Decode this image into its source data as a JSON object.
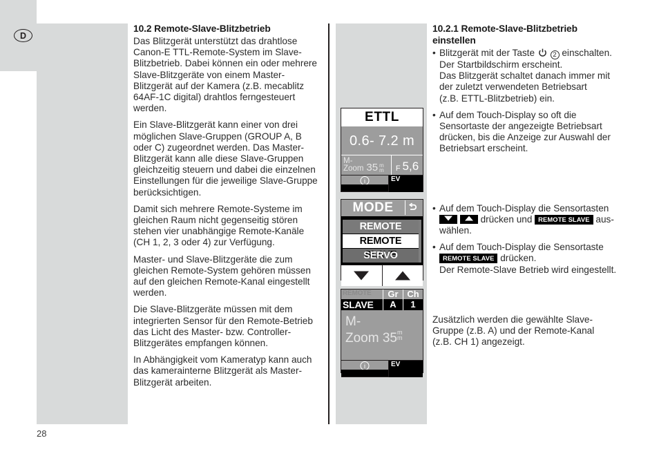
{
  "page": {
    "number": "28",
    "locale_badge": "D"
  },
  "left_column": {
    "heading": "10.2 Remote-Slave-Blitzbetrieb",
    "paragraphs": [
      "Das Blitzgerät unterstützt das drahtlose Canon-E TTL-Remote-System im Slave-Blitzbetrieb. Dabei können ein oder mehrere Slave-Blitzgeräte von einem Master-Blitzgerät auf der Kamera (z.B. mecablitz 64AF-1C digital) drahtlos ferngesteuert werden.",
      "Ein Slave-Blitzgerät kann einer von drei möglichen Slave-Gruppen (GROUP A, B oder C) zugeordnet werden. Das Master-Blitzgerät kann alle diese Slave-Gruppen gleichzeitig steuern und dabei die einzelnen Einstellungen für die jeweilige Slave-Gruppe berücksichtigen.",
      "Damit sich mehrere Remote-Systeme im gleichen Raum nicht gegenseitig stören stehen vier unabhängige Remote-Kanäle (CH 1, 2, 3 oder 4) zur Verfügung.",
      "Master- und Slave-Blitzgeräte die zum gleichen Remote-System gehören müssen auf den gleichen Remote-Kanal eingestellt werden.",
      "Die Slave-Blitzgeräte müssen mit dem integrierten Sensor für den Remote-Betrieb  das Licht des Master- bzw. Controller-Blitzgerätes empfangen können.",
      "In Abhängigkeit vom Kameratyp kann auch das kamerainterne Blitzgerät als Master-Blitzgerät arbeiten."
    ]
  },
  "right_column": {
    "heading": "10.2.1 Remote-Slave-Blitzbetrieb einstellen",
    "bullet1": {
      "lead": "Blitzgerät mit der Taste",
      "button_number": "2",
      "after": "einschalten.",
      "line2": "Der Startbildschirm erscheint.",
      "line3": "Das Blitzgerät schaltet danach immer mit",
      "line4": "der zuletzt verwendeten Betriebsart",
      "line5": "(z.B. ETTL-Blitzbetrieb) ein."
    },
    "bullet2": {
      "line1": "Auf dem Touch-Display so oft die",
      "line2": "Sensortaste der angezeigte Betriebsart",
      "line3": "drücken, bis die Anzeige zur Auswahl der",
      "line4": "Betriebsart erscheint."
    },
    "bullet3": {
      "line1": "Auf dem Touch-Display die Sensortasten",
      "mid": "drücken und",
      "keycap": "REMOTE SLAVE",
      "tail": "aus-",
      "line3": "wählen."
    },
    "bullet4": {
      "line1": "Auf dem Touch-Display die Sensortaste",
      "keycap": "REMOTE SLAVE",
      "tail": "drücken.",
      "line3": "Der Remote-Slave Betrieb wird eingestellt."
    },
    "note": [
      "Zusätzlich werden die gewählte Slave-",
      "Gruppe (z.B. A) und der Remote-Kanal",
      "(z.B. CH 1) angezeigt."
    ]
  },
  "lcd_panels": {
    "panel1": {
      "title": "ETTL",
      "distance": "0.6- 7.2 m",
      "zoom_label_line1": "M-",
      "zoom_label_line2": "Zoom",
      "zoom_value": "35",
      "zoom_unit_top": "m",
      "zoom_unit_bottom": "m",
      "fstop_prefix": "F",
      "fstop_value": "5,6",
      "info_glyph": "i",
      "ev_label": "EV"
    },
    "panel2": {
      "title": "MODE",
      "back_icon": "back-arrow-icon",
      "items": [
        {
          "label": "REMOTE MASTER",
          "state": "dim"
        },
        {
          "label": "REMOTE SLAVE",
          "state": "selected"
        },
        {
          "label": "SERVO",
          "state": "dim"
        }
      ],
      "nav_down": "down-arrow-icon",
      "nav_up": "up-arrow-icon"
    },
    "panel3": {
      "remote_label": "REMOTE",
      "slave_label": "SLAVE",
      "gr_header": "Gr",
      "gr_value": "A",
      "ch_header": "Ch",
      "ch_value": "1",
      "mz_line1": "M-",
      "mz_line2": "Zoom",
      "mz_value": "35",
      "mz_unit_top": "m",
      "mz_unit_bottom": "m",
      "info_glyph": "i",
      "ev_label": "EV"
    }
  },
  "colors": {
    "panel_gray": "#d8dada",
    "lcd_gray": "#9d9d9d",
    "ink": "#231f20"
  }
}
